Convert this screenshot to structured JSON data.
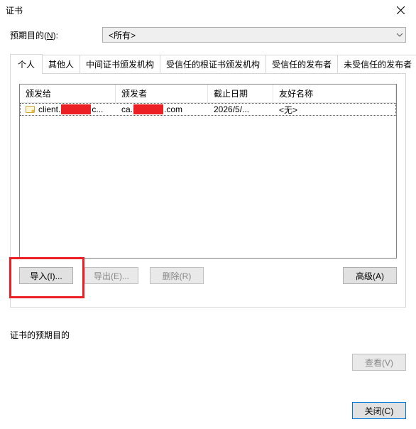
{
  "window": {
    "title": "证书"
  },
  "purpose": {
    "label_pre": "预期目的(",
    "label_hotkey": "N",
    "label_post": "):",
    "selected": "<所有>"
  },
  "tabs": [
    {
      "label": "个人",
      "active": true
    },
    {
      "label": "其他人",
      "active": false
    },
    {
      "label": "中间证书颁发机构",
      "active": false
    },
    {
      "label": "受信任的根证书颁发机构",
      "active": false
    },
    {
      "label": "受信任的发布者",
      "active": false
    },
    {
      "label": "未受信任的发布者",
      "active": false
    }
  ],
  "columns": [
    {
      "label": "颁发给"
    },
    {
      "label": "颁发者"
    },
    {
      "label": "截止日期"
    },
    {
      "label": "友好名称"
    }
  ],
  "rows": [
    {
      "issued_to_pre": "client.",
      "issued_to_mid_redacted": "xxxxxxx",
      "issued_to_suf": "c...",
      "issuer_pre": "ca.",
      "issuer_mid_redacted": "xxxxxxx",
      "issuer_suf": ".com",
      "expires": "2026/5/...",
      "friendly": "<无>"
    }
  ],
  "buttons": {
    "import": "导入(I)...",
    "export": "导出(E)...",
    "delete": "删除(R)",
    "advanced": "高级(A)"
  },
  "lower": {
    "label": "证书的预期目的",
    "view": "查看(V)"
  },
  "close": "关闭(C)"
}
